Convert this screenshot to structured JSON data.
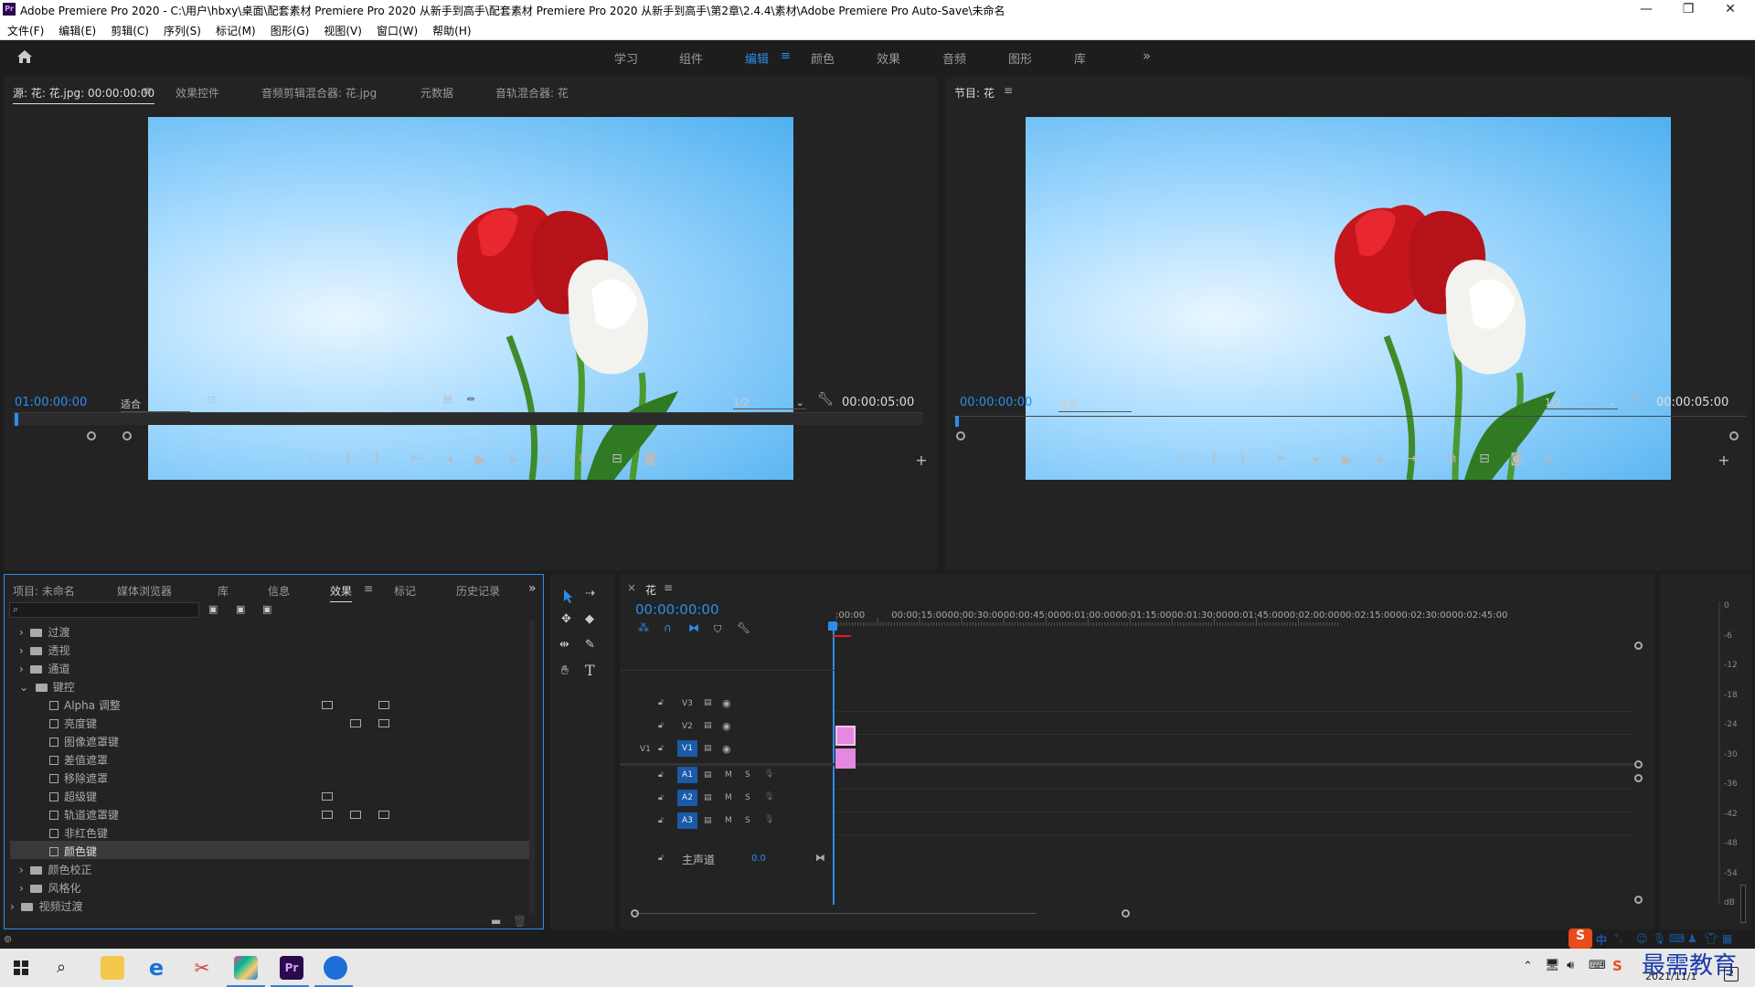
{
  "window": {
    "app_badge": "Pr",
    "title": "Adobe Premiere Pro 2020 - C:\\用户\\hbxy\\桌面\\配套素材 Premiere Pro 2020 从新手到高手\\配套素材 Premiere Pro 2020 从新手到高手\\第2章\\2.4.4\\素材\\Adobe Premiere Pro Auto-Save\\未命名 *",
    "minimize": "—",
    "restore": "❐",
    "close": "✕"
  },
  "menu": [
    "文件(F)",
    "编辑(E)",
    "剪辑(C)",
    "序列(S)",
    "标记(M)",
    "图形(G)",
    "视图(V)",
    "窗口(W)",
    "帮助(H)"
  ],
  "workspaces": {
    "items": [
      "学习",
      "组件",
      "编辑",
      "颜色",
      "效果",
      "音频",
      "图形",
      "库"
    ],
    "active": "编辑",
    "more": "»"
  },
  "source_monitor": {
    "tabs": [
      "源: 花: 花.jpg: 00:00:00:00",
      "效果控件",
      "音频剪辑混合器: 花.jpg",
      "元数据",
      "音轨混合器: 花"
    ],
    "timecode": "01:00:00:00",
    "fit": "适合",
    "resolution": "1/2",
    "duration": "00:00:05:00"
  },
  "program_monitor": {
    "tab": "节目: 花",
    "timecode": "00:00:00:00",
    "fit": "适合",
    "resolution": "1/2",
    "duration": "00:00:05:00"
  },
  "project_panel": {
    "tabs": [
      "项目: 未命名",
      "媒体浏览器",
      "库",
      "信息",
      "效果",
      "标记",
      "历史记录"
    ],
    "active": "效果",
    "more": "»",
    "tree": [
      {
        "label": "过渡",
        "kind": "folder",
        "open": false,
        "level": 1
      },
      {
        "label": "透视",
        "kind": "folder",
        "open": false,
        "level": 1
      },
      {
        "label": "通道",
        "kind": "folder",
        "open": false,
        "level": 1
      },
      {
        "label": "键控",
        "kind": "folder",
        "open": true,
        "level": 1
      },
      {
        "label": "Alpha 调整",
        "kind": "effect",
        "level": 2
      },
      {
        "label": "亮度键",
        "kind": "effect",
        "level": 2
      },
      {
        "label": "图像遮罩键",
        "kind": "effect",
        "level": 2
      },
      {
        "label": "差值遮罩",
        "kind": "effect",
        "level": 2
      },
      {
        "label": "移除遮罩",
        "kind": "effect",
        "level": 2
      },
      {
        "label": "超级键",
        "kind": "effect",
        "level": 2
      },
      {
        "label": "轨道遮罩键",
        "kind": "effect",
        "level": 2
      },
      {
        "label": "非红色键",
        "kind": "effect",
        "level": 2
      },
      {
        "label": "颜色键",
        "kind": "effect",
        "level": 2,
        "selected": true
      },
      {
        "label": "颜色校正",
        "kind": "folder",
        "open": false,
        "level": 1
      },
      {
        "label": "风格化",
        "kind": "folder",
        "open": false,
        "level": 1
      },
      {
        "label": "视频过渡",
        "kind": "folder",
        "open": false,
        "level": 0
      }
    ]
  },
  "timeline": {
    "sequence": "花",
    "timecode": "00:00:00:00",
    "ruler_labels": [
      ":00:00",
      "00:00:15:00",
      "00:00:30:00",
      "00:00:45:00",
      "00:01:00:00",
      "00:01:15:00",
      "00:01:30:00",
      "00:01:45:00",
      "00:02:00:00",
      "00:02:15:00",
      "00:02:30:00",
      "00:02:45:00"
    ],
    "video_tracks": [
      "V3",
      "V2",
      "V1"
    ],
    "source_patch": "V1",
    "audio_tracks": [
      "A1",
      "A2",
      "A3"
    ],
    "mute_label": "M",
    "solo_label": "S",
    "master_label": "主声道",
    "master_value": "0.0",
    "close_x": "×"
  },
  "meter": {
    "labels": [
      "0",
      "-6",
      "-12",
      "-18",
      "-24",
      "-30",
      "-36",
      "-42",
      "-48",
      "-54",
      "dB"
    ]
  },
  "tray": {
    "ime": "中",
    "ime_punct": "°,",
    "watermark": "最需教育",
    "date": "2021/11/1",
    "notify": "2"
  },
  "colors": {
    "accent": "#2d8ceb",
    "clip": "#e38ae0",
    "playhead": "#2d8ceb",
    "track_active": "#1a5aa6"
  }
}
